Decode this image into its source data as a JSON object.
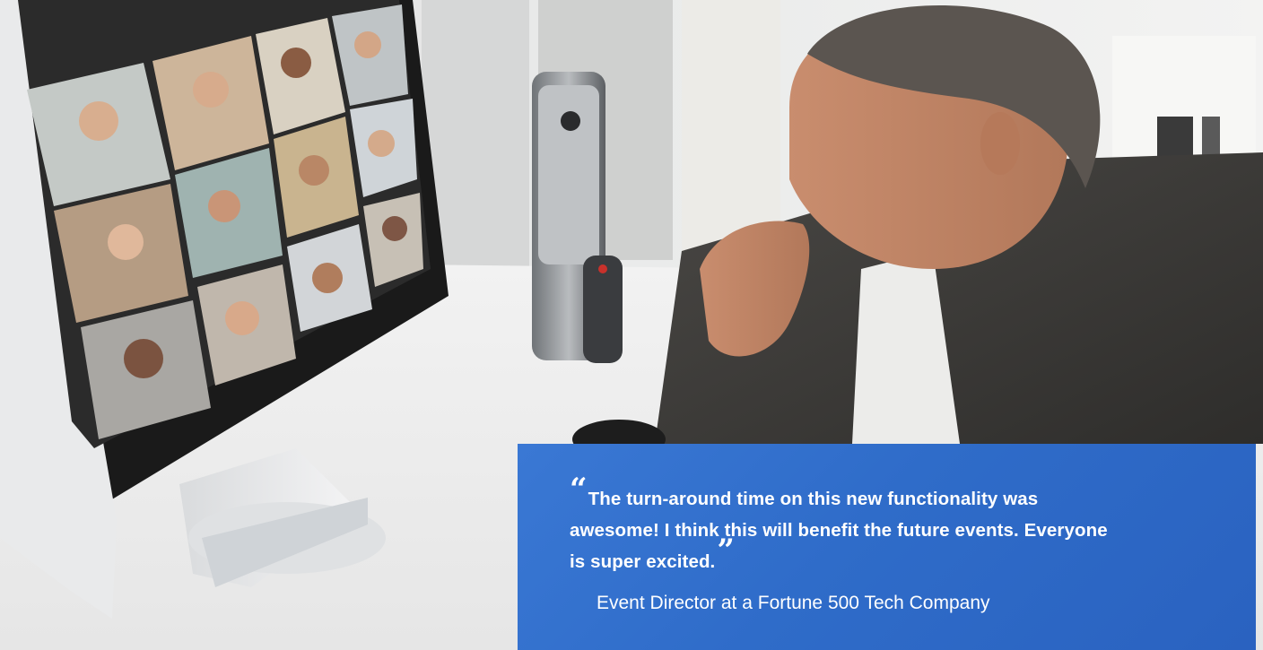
{
  "testimonial": {
    "open_quote": "“",
    "quote": "The turn-around time on this new functionality was awesome! I think this will benefit the future events. Everyone is super excited.",
    "close_quote": "”",
    "attribution": "Event Director at a Fortune 500 Tech Company"
  },
  "colors": {
    "quote_panel": "#2f6cc9",
    "quote_text": "#ffffff"
  }
}
